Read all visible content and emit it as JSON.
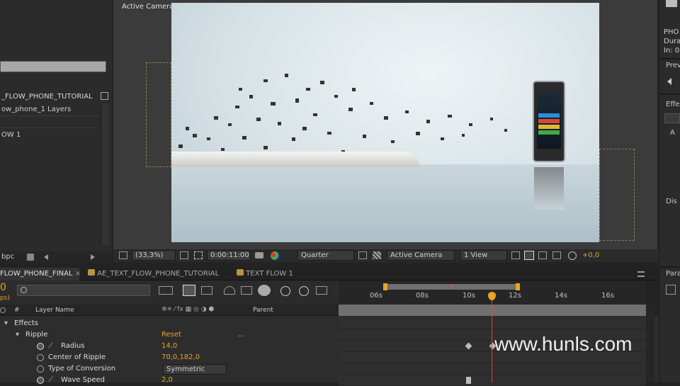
{
  "project": {
    "comp_name": "_FLOW_PHONE_TUTORIAL",
    "layers_label": "ow_phone_1 Layers",
    "flow_label": "OW 1",
    "bpc": "bpc"
  },
  "viewer": {
    "title": "Active Camera",
    "zoom": "(33,3%)",
    "timecode": "0:00:11:00",
    "resolution": "Quarter",
    "camera": "Active Camera",
    "views": "1 View",
    "exposure": "+0,0"
  },
  "right_panel": {
    "name": "PHO",
    "duration": "Dura",
    "in": "In: 0",
    "preview": "Prev",
    "effects": "Effe",
    "item_a": "A",
    "item_dis": "Dis",
    "paragraph": "Para"
  },
  "timeline": {
    "tabs": [
      "FLOW_PHONE_FINAL",
      "AE_TEXT_FLOW_PHONE_TUTORIAL",
      "TEXT FLOW 1"
    ],
    "current_time": "0",
    "fps": "ps)",
    "col_number": "#",
    "col_layer": "Layer Name",
    "col_parent": "Parent",
    "ticks": [
      "06s",
      "08s",
      "10s",
      "12s",
      "14s",
      "16s"
    ],
    "rows": [
      {
        "label": "Effects",
        "value": ""
      },
      {
        "label": "Ripple",
        "value": "Reset",
        "extra": "..."
      },
      {
        "label": "Radius",
        "value": "14,0"
      },
      {
        "label": "Center of Ripple",
        "value": "70,0,182,0"
      },
      {
        "label": "Type of Conversion",
        "value": "Symmetric"
      },
      {
        "label": "Wave Speed",
        "value": "2,0"
      }
    ]
  },
  "watermark": "www.hunls.com"
}
